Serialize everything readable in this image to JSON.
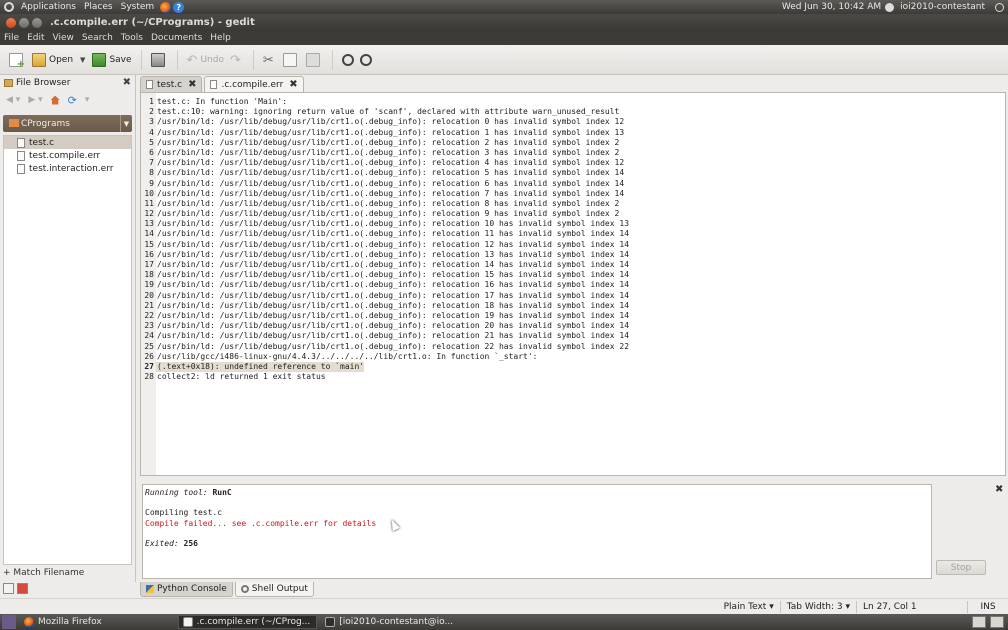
{
  "top_panel": {
    "menus": [
      "Applications",
      "Places",
      "System"
    ],
    "datetime": "Wed Jun 30, 10:42 AM",
    "user": "ioi2010-contestant",
    "help_glyph": "?"
  },
  "window": {
    "title": ".c.compile.err (~/CPrograms) - gedit"
  },
  "menu_bar": [
    "File",
    "Edit",
    "View",
    "Search",
    "Tools",
    "Documents",
    "Help"
  ],
  "toolbar": {
    "open_label": "Open",
    "save_label": "Save",
    "undo_label": "Undo"
  },
  "side_pane": {
    "title": "File Browser",
    "location": "CPrograms",
    "files": [
      "test.c",
      "test.compile.err",
      "test.interaction.err"
    ],
    "selected_index": 0,
    "match_filename": "Match Filename"
  },
  "tabs": [
    {
      "label": "test.c",
      "active": false
    },
    {
      "label": ".c.compile.err",
      "active": true
    }
  ],
  "editor": {
    "current_line": 27,
    "lines": [
      "test.c: In function 'Main':",
      "test.c:10: warning: ignoring return value of 'scanf', declared with attribute warn_unused_result",
      "/usr/bin/ld: /usr/lib/debug/usr/lib/crt1.o(.debug_info): relocation 0 has invalid symbol index 12",
      "/usr/bin/ld: /usr/lib/debug/usr/lib/crt1.o(.debug_info): relocation 1 has invalid symbol index 13",
      "/usr/bin/ld: /usr/lib/debug/usr/lib/crt1.o(.debug_info): relocation 2 has invalid symbol index 2",
      "/usr/bin/ld: /usr/lib/debug/usr/lib/crt1.o(.debug_info): relocation 3 has invalid symbol index 2",
      "/usr/bin/ld: /usr/lib/debug/usr/lib/crt1.o(.debug_info): relocation 4 has invalid symbol index 12",
      "/usr/bin/ld: /usr/lib/debug/usr/lib/crt1.o(.debug_info): relocation 5 has invalid symbol index 14",
      "/usr/bin/ld: /usr/lib/debug/usr/lib/crt1.o(.debug_info): relocation 6 has invalid symbol index 14",
      "/usr/bin/ld: /usr/lib/debug/usr/lib/crt1.o(.debug_info): relocation 7 has invalid symbol index 14",
      "/usr/bin/ld: /usr/lib/debug/usr/lib/crt1.o(.debug_info): relocation 8 has invalid symbol index 2",
      "/usr/bin/ld: /usr/lib/debug/usr/lib/crt1.o(.debug_info): relocation 9 has invalid symbol index 2",
      "/usr/bin/ld: /usr/lib/debug/usr/lib/crt1.o(.debug_info): relocation 10 has invalid symbol index 13",
      "/usr/bin/ld: /usr/lib/debug/usr/lib/crt1.o(.debug_info): relocation 11 has invalid symbol index 14",
      "/usr/bin/ld: /usr/lib/debug/usr/lib/crt1.o(.debug_info): relocation 12 has invalid symbol index 14",
      "/usr/bin/ld: /usr/lib/debug/usr/lib/crt1.o(.debug_info): relocation 13 has invalid symbol index 14",
      "/usr/bin/ld: /usr/lib/debug/usr/lib/crt1.o(.debug_info): relocation 14 has invalid symbol index 14",
      "/usr/bin/ld: /usr/lib/debug/usr/lib/crt1.o(.debug_info): relocation 15 has invalid symbol index 14",
      "/usr/bin/ld: /usr/lib/debug/usr/lib/crt1.o(.debug_info): relocation 16 has invalid symbol index 14",
      "/usr/bin/ld: /usr/lib/debug/usr/lib/crt1.o(.debug_info): relocation 17 has invalid symbol index 14",
      "/usr/bin/ld: /usr/lib/debug/usr/lib/crt1.o(.debug_info): relocation 18 has invalid symbol index 14",
      "/usr/bin/ld: /usr/lib/debug/usr/lib/crt1.o(.debug_info): relocation 19 has invalid symbol index 14",
      "/usr/bin/ld: /usr/lib/debug/usr/lib/crt1.o(.debug_info): relocation 20 has invalid symbol index 14",
      "/usr/bin/ld: /usr/lib/debug/usr/lib/crt1.o(.debug_info): relocation 21 has invalid symbol index 14",
      "/usr/bin/ld: /usr/lib/debug/usr/lib/crt1.o(.debug_info): relocation 22 has invalid symbol index 22",
      "/usr/lib/gcc/i486-linux-gnu/4.4.3/../../../../lib/crt1.o: In function `_start':",
      "(.text+0x18): undefined reference to `main'",
      "collect2: ld returned 1 exit status"
    ]
  },
  "output": {
    "running_label": "Running tool:",
    "tool_name": "RunC",
    "compiling": "Compiling test.c",
    "error": "Compile failed... see .c.compile.err for details",
    "exited_label": "Exited:",
    "exit_code": "256",
    "stop_label": "Stop"
  },
  "bottom_tabs": [
    {
      "label": "Python Console",
      "active": true
    },
    {
      "label": "Shell Output",
      "active": false
    }
  ],
  "status_bar": {
    "language": "Plain Text",
    "tab_width": "Tab Width: 3",
    "position": "Ln 27, Col 1",
    "mode": "INS"
  },
  "taskbar": [
    {
      "label": "Mozilla Firefox",
      "icon": "firefox-icon",
      "active": false
    },
    {
      "label": ".c.compile.err (~/CProg...",
      "icon": "gedit-icon",
      "active": true
    },
    {
      "label": "[ioi2010-contestant@io...",
      "icon": "terminal-icon",
      "active": false
    }
  ],
  "colors": {
    "error_text": "#d01616",
    "panel_dark": "#3c3b37",
    "current_line_bg": "#e4dccf"
  }
}
